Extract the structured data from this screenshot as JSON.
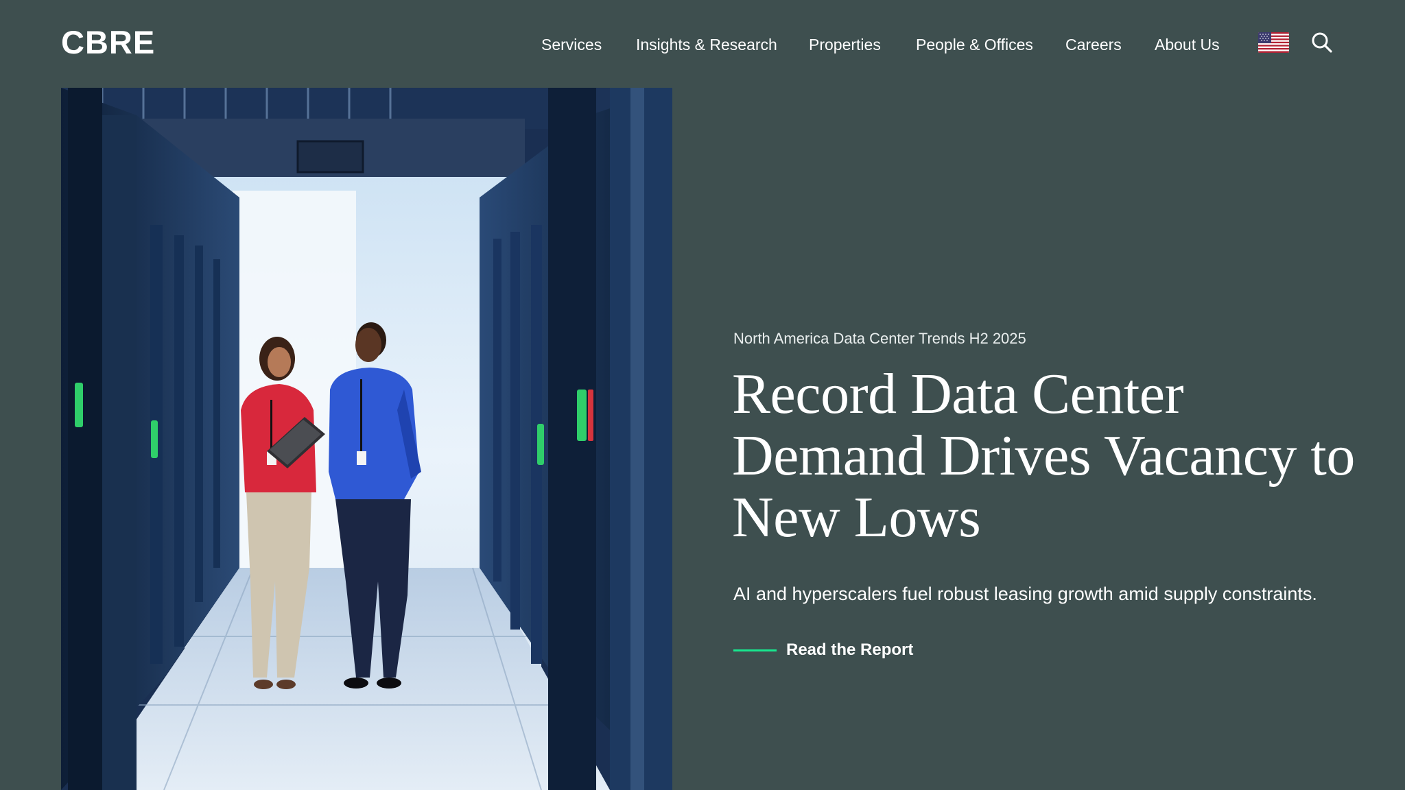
{
  "header": {
    "logo": "CBRE",
    "nav": [
      {
        "label": "Services"
      },
      {
        "label": "Insights & Research"
      },
      {
        "label": "Properties"
      },
      {
        "label": "People & Offices"
      },
      {
        "label": "Careers"
      },
      {
        "label": "About Us"
      }
    ],
    "flag_icon": "us-flag-icon",
    "search_icon": "search-icon"
  },
  "hero": {
    "image_icon": "data-center-photo",
    "eyebrow": "North America Data Center Trends H2 2025",
    "headline": "Record Data Center Demand Drives Vacancy to New Lows",
    "subhead": "AI and hyperscalers fuel robust leasing growth amid supply constraints.",
    "cta_label": "Read the Report"
  },
  "colors": {
    "background": "#3e4f4f",
    "accent": "#17e88f",
    "text": "#ffffff"
  }
}
